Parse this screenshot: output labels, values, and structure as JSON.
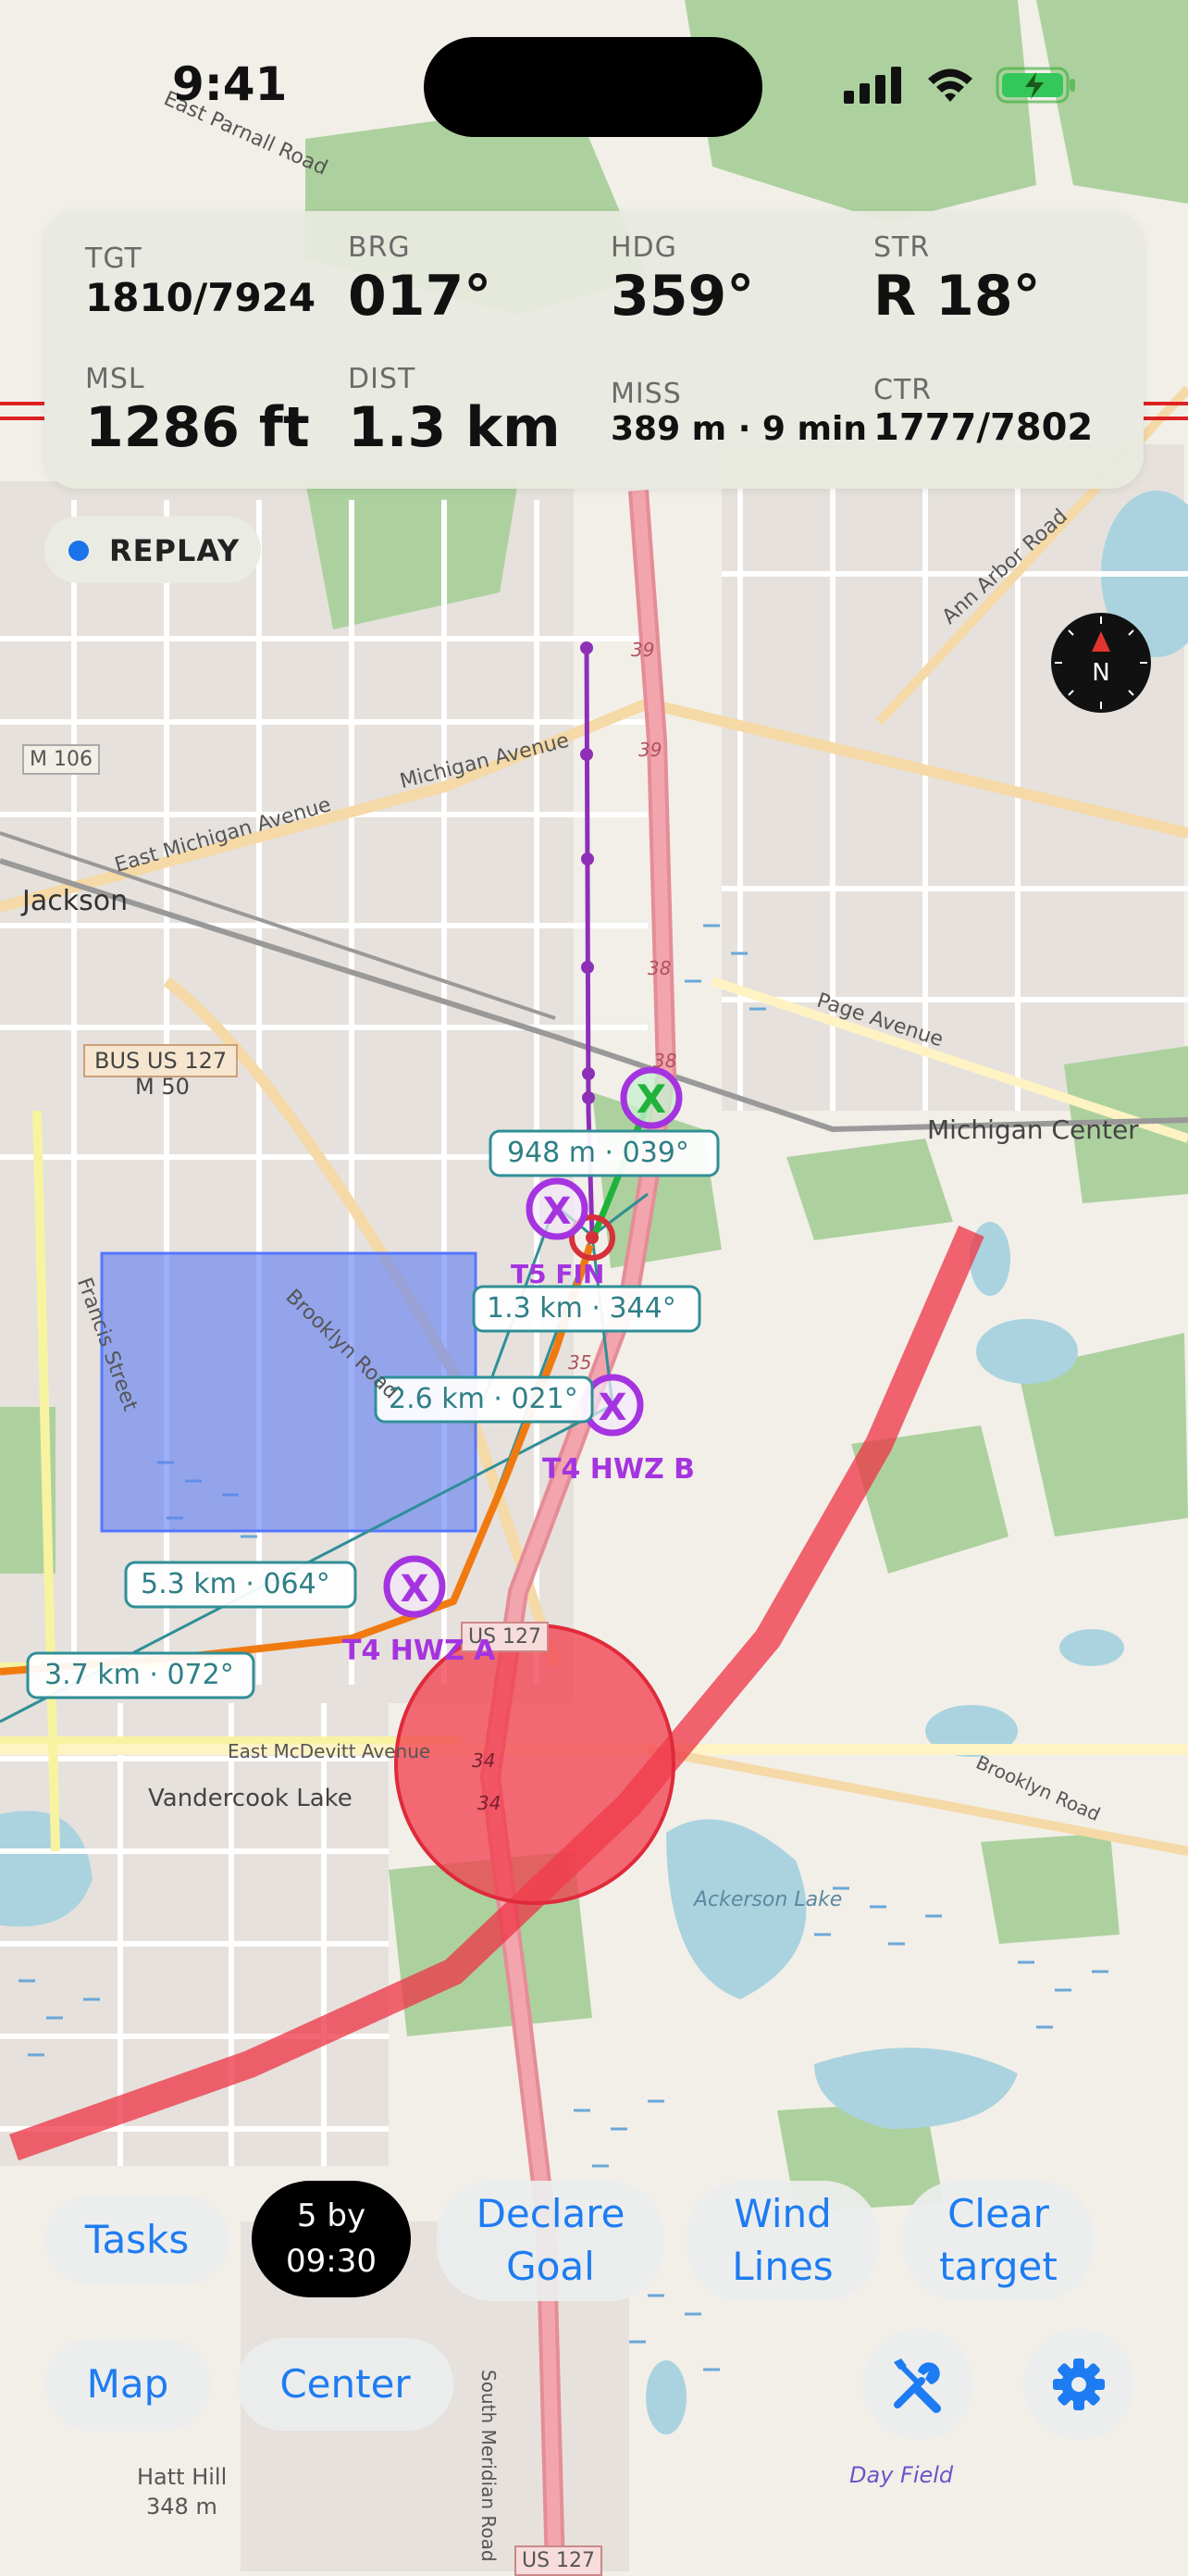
{
  "status_bar": {
    "time": "9:41"
  },
  "panel": {
    "tgt": {
      "label": "TGT",
      "value": "1810/7924"
    },
    "brg": {
      "label": "BRG",
      "value": "017°"
    },
    "hdg": {
      "label": "HDG",
      "value": "359°"
    },
    "str": {
      "label": "STR",
      "value": "R 18°"
    },
    "msl": {
      "label": "MSL",
      "value": "1286 ft"
    },
    "dist": {
      "label": "DIST",
      "value": "1.3 km"
    },
    "miss": {
      "label": "MISS",
      "value": "389 m · 9 min"
    },
    "ctr": {
      "label": "CTR",
      "value": "1777/7802"
    }
  },
  "replay": {
    "label": "REPLAY"
  },
  "compass": {
    "label": "N"
  },
  "map": {
    "streets": [
      "East Parnall Road",
      "Ann Arbor Road",
      "Michigan Avenue",
      "East Michigan Avenue",
      "Page Avenue",
      "Michigan Center",
      "Brooklyn Road",
      "Francis Street",
      "East McDevitt Avenue",
      "South Meridian Road",
      "Brooklyn Road"
    ],
    "places": [
      "Jackson",
      "Vandercook Lake",
      "Ackerson Lake",
      "Hatt Hill",
      "348 m",
      "Day Field"
    ],
    "shields": [
      "M 106",
      "BUS US 127",
      "M 50",
      "US 127",
      "US 127"
    ],
    "route_numbers": [
      "39",
      "39",
      "38",
      "38",
      "35",
      "34",
      "34"
    ],
    "pins": [
      "T5 FIN",
      "T4 HWZ B",
      "T4 HWZ A"
    ],
    "range_labels": [
      "948 m · 039°",
      "1.3 km · 344°",
      "2.6 km · 021°",
      "5.3 km · 064°",
      "3.7 km · 072°"
    ]
  },
  "toolbar": {
    "tasks": "Tasks",
    "task_badge_line1": "5  by",
    "task_badge_line2": "09:30",
    "declare_goal_line1": "Declare",
    "declare_goal_line2": "Goal",
    "wind_lines_line1": "Wind",
    "wind_lines_line2": "Lines",
    "clear_target_line1": "Clear",
    "clear_target_line2": "target",
    "map": "Map",
    "center": "Center"
  },
  "colors": {
    "accent": "#1e7cf2",
    "track": "#8e2fb8",
    "pin": "#a534e0",
    "range_line": "#2f8f96",
    "hazard": "#ee3344",
    "airspace": "#5577ff",
    "heading": "#f07a10",
    "goal": "#1fb33b"
  },
  "icons": [
    "signal-icon",
    "wifi-icon",
    "battery-icon",
    "compass-icon",
    "tools-icon",
    "gear-icon"
  ]
}
